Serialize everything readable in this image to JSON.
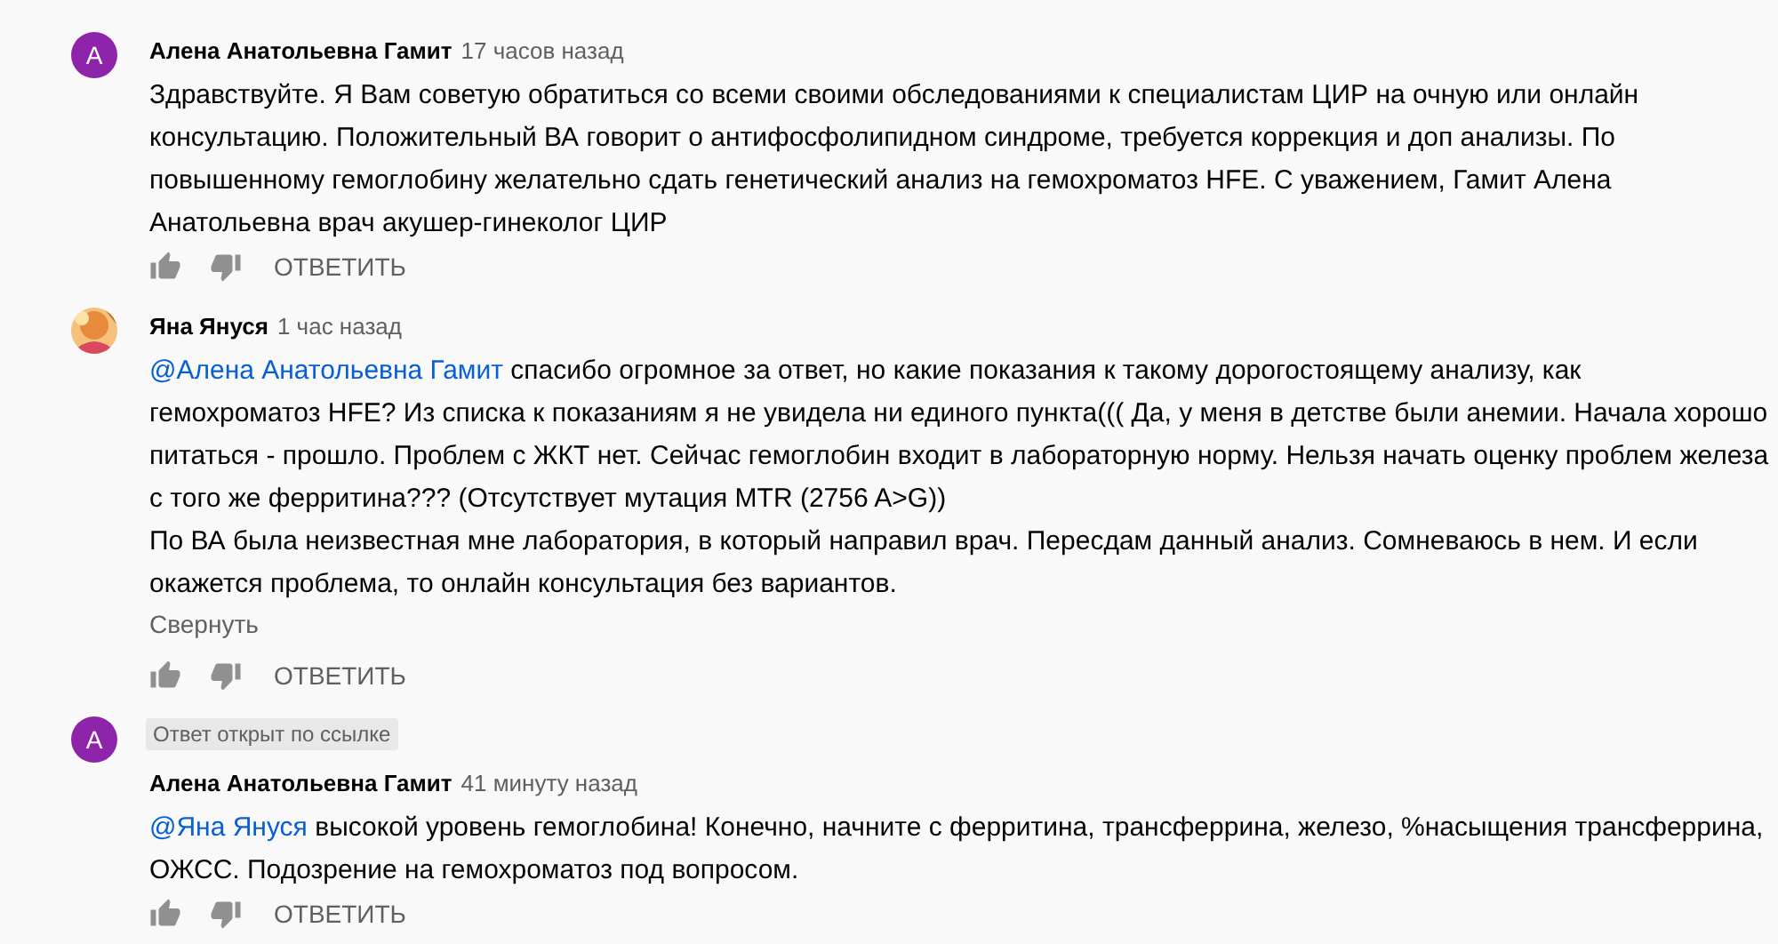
{
  "comments": [
    {
      "avatar": {
        "kind": "letter",
        "letter": "А",
        "color": "#8e24aa"
      },
      "author": "Алена Анатольевна Гамит",
      "time": "17 часов назад",
      "body": [
        {
          "lines": [
            "Здравствуйте. Я Вам советую обратиться со всеми своими обследованиями к специалистам ЦИР на очную или онлайн",
            "консультацию. Положительный ВА говорит о антифосфолипидном синдроме, требуется коррекция и доп анализы. По",
            "повышенному гемоглобину желательно сдать генетический анализ на гемохроматоз HFE. С уважением, Гамит Алена",
            "Анатольевна врач акушер-гинеколог ЦИР"
          ]
        }
      ],
      "reply": "ОТВЕТИТЬ"
    },
    {
      "avatar": {
        "kind": "picture"
      },
      "author": "Яна Януся",
      "time": "1 час назад",
      "mention": "@Алена Анатольевна Гамит",
      "body": [
        {
          "lines": [
            "спасибо огромное за ответ, но какие показания к такому дорогостоящему анализу, как",
            "гемохроматоз HFE? Из списка к показаниям я не увидела ни единого пункта((( Да, у меня в детстве были анемии. Начала хорошо",
            "питаться - прошло. Проблем с ЖКТ нет. Сейчас гемоглобин входит в лабораторную норму. Нельзя начать оценку проблем железа",
            "с того же ферритина??? (Отсутствует мутация MTR (2756 A>G))"
          ]
        },
        {
          "lines": [
            "По ВА была неизвестная мне лаборатория, в который направил врач. Пересдам данный анализ. Сомневаюсь в нем. И если",
            "окажется проблема, то онлайн консультация без вариантов."
          ]
        }
      ],
      "collapse": "Свернуть",
      "reply": "ОТВЕТИТЬ"
    },
    {
      "avatar": {
        "kind": "letter",
        "letter": "А",
        "color": "#8e24aa"
      },
      "badge": "Ответ открыт по ссылке",
      "author": "Алена Анатольевна Гамит",
      "time": "41 минуту назад",
      "mention": "@Яна Януся",
      "body": [
        {
          "lines": [
            "высокой уровень гемоглобина! Конечно, начните с ферритина, трансферрина, железо, %насыщения трансферрина,",
            "ОЖСС. Подозрение на гемохроматоз под вопросом."
          ]
        }
      ],
      "reply": "ОТВЕТИТЬ"
    }
  ]
}
